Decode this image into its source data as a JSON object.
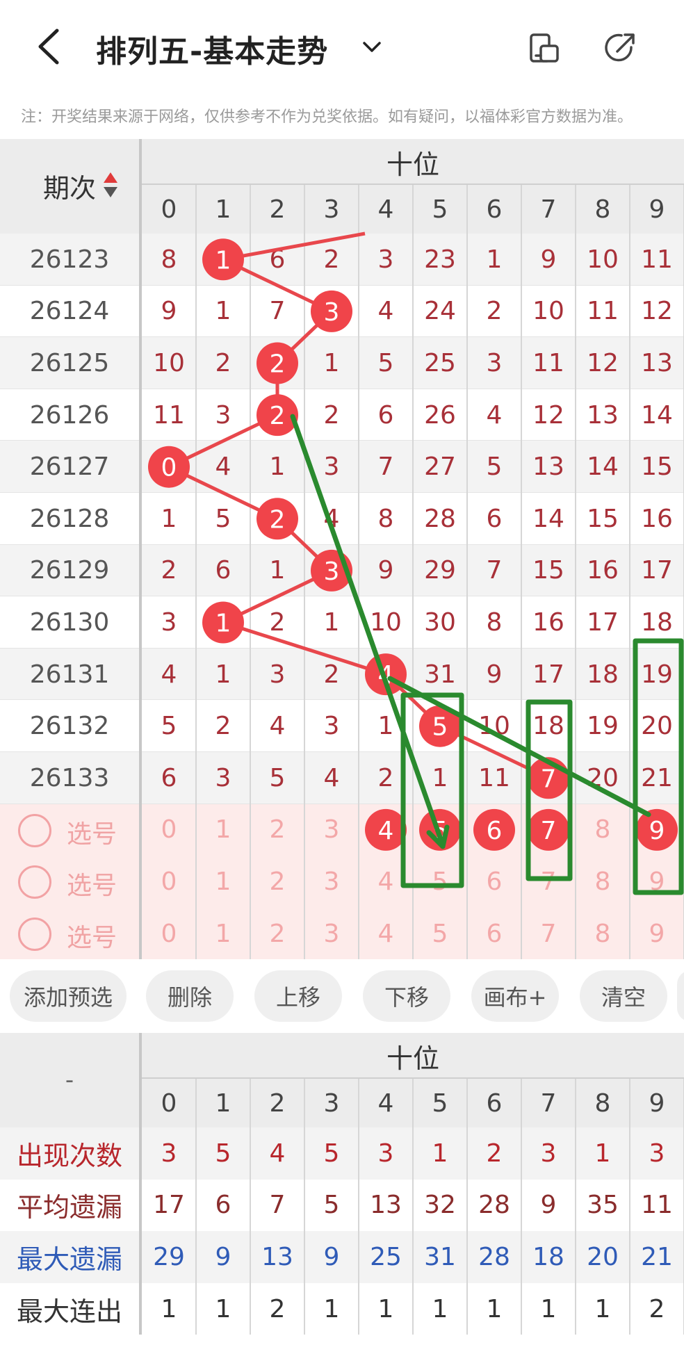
{
  "header": {
    "title": "排列五-基本走势",
    "notice": "注：开奖结果来源于网络，仅供参考不作为兑奖依据。如有疑问，以福体彩官方数据为准。"
  },
  "trend": {
    "period_header": "期次",
    "group_label": "十位",
    "digits": [
      "0",
      "1",
      "2",
      "3",
      "4",
      "5",
      "6",
      "7",
      "8",
      "9"
    ],
    "rows": [
      {
        "period": "26123",
        "cells": [
          "8",
          "1",
          "6",
          "2",
          "3",
          "23",
          "1",
          "9",
          "10",
          "11"
        ],
        "hit": 1
      },
      {
        "period": "26124",
        "cells": [
          "9",
          "1",
          "7",
          "3",
          "4",
          "24",
          "2",
          "10",
          "11",
          "12"
        ],
        "hit": 3
      },
      {
        "period": "26125",
        "cells": [
          "10",
          "2",
          "2",
          "1",
          "5",
          "25",
          "3",
          "11",
          "12",
          "13"
        ],
        "hit": 2
      },
      {
        "period": "26126",
        "cells": [
          "11",
          "3",
          "2",
          "2",
          "6",
          "26",
          "4",
          "12",
          "13",
          "14"
        ],
        "hit": 2
      },
      {
        "period": "26127",
        "cells": [
          "0",
          "4",
          "1",
          "3",
          "7",
          "27",
          "5",
          "13",
          "14",
          "15"
        ],
        "hit": 0
      },
      {
        "period": "26128",
        "cells": [
          "1",
          "5",
          "2",
          "4",
          "8",
          "28",
          "6",
          "14",
          "15",
          "16"
        ],
        "hit": 2
      },
      {
        "period": "26129",
        "cells": [
          "2",
          "6",
          "1",
          "3",
          "9",
          "29",
          "7",
          "15",
          "16",
          "17"
        ],
        "hit": 3
      },
      {
        "period": "26130",
        "cells": [
          "3",
          "1",
          "2",
          "1",
          "10",
          "30",
          "8",
          "16",
          "17",
          "18"
        ],
        "hit": 1
      },
      {
        "period": "26131",
        "cells": [
          "4",
          "1",
          "3",
          "2",
          "4",
          "31",
          "9",
          "17",
          "18",
          "19"
        ],
        "hit": 4
      },
      {
        "period": "26132",
        "cells": [
          "5",
          "2",
          "4",
          "3",
          "1",
          "5",
          "10",
          "18",
          "19",
          "20"
        ],
        "hit": 5
      },
      {
        "period": "26133",
        "cells": [
          "6",
          "3",
          "5",
          "4",
          "2",
          "1",
          "11",
          "7",
          "20",
          "21"
        ],
        "hit": 7
      }
    ],
    "select_rows": [
      {
        "label": "选号",
        "selected": [
          4,
          5,
          6,
          7,
          9
        ]
      },
      {
        "label": "选号",
        "selected": []
      },
      {
        "label": "选号",
        "selected": []
      }
    ]
  },
  "toolbar": {
    "buttons": [
      "添加预选",
      "删除",
      "上移",
      "下移",
      "画布+",
      "清空"
    ]
  },
  "stats": {
    "corner": "-",
    "group_label": "十位",
    "rows": [
      {
        "label": "出现次数",
        "values": [
          "3",
          "5",
          "4",
          "5",
          "3",
          "1",
          "2",
          "3",
          "1",
          "3"
        ],
        "color": "#b8262c"
      },
      {
        "label": "平均遗漏",
        "values": [
          "17",
          "6",
          "7",
          "5",
          "13",
          "32",
          "28",
          "9",
          "35",
          "11"
        ],
        "color": "#8a2c2c"
      },
      {
        "label": "最大遗漏",
        "values": [
          "29",
          "9",
          "13",
          "9",
          "25",
          "31",
          "28",
          "18",
          "20",
          "21"
        ],
        "color": "#2f5bb7"
      },
      {
        "label": "最大连出",
        "values": [
          "1",
          "1",
          "2",
          "1",
          "1",
          "1",
          "1",
          "1",
          "1",
          "2"
        ],
        "color": "#333333"
      }
    ]
  },
  "colors": {
    "accent_red": "#f0444a",
    "trend_line": "#e8474c",
    "number_red": "#a83038",
    "annotation_green": "#2a8a2e",
    "select_bg": "#fdebea"
  }
}
